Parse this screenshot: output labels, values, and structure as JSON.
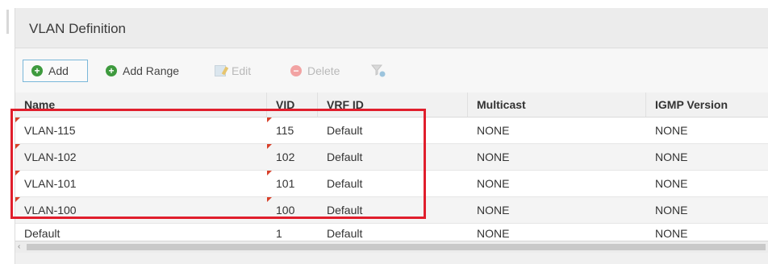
{
  "panel": {
    "title": "VLAN Definition"
  },
  "toolbar": {
    "add_label": "Add",
    "add_range_label": "Add Range",
    "edit_label": "Edit",
    "delete_label": "Delete"
  },
  "table": {
    "headers": {
      "name": "Name",
      "vid": "VID",
      "vrf": "VRF ID",
      "multicast": "Multicast",
      "igmp": "IGMP Version"
    },
    "rows": [
      {
        "name": "VLAN-115",
        "vid": "115",
        "vrf": "Default",
        "multicast": "NONE",
        "igmp": "NONE"
      },
      {
        "name": "VLAN-102",
        "vid": "102",
        "vrf": "Default",
        "multicast": "NONE",
        "igmp": "NONE"
      },
      {
        "name": "VLAN-101",
        "vid": "101",
        "vrf": "Default",
        "multicast": "NONE",
        "igmp": "NONE"
      },
      {
        "name": "VLAN-100",
        "vid": "100",
        "vrf": "Default",
        "multicast": "NONE",
        "igmp": "NONE"
      },
      {
        "name": "Default",
        "vid": "1",
        "vrf": "Default",
        "multicast": "NONE",
        "igmp": "NONE"
      }
    ]
  },
  "scrollbar": {
    "left_arrow": "‹"
  },
  "icons": {
    "add": "plus-circle-icon",
    "add_range": "plus-circle-icon",
    "edit": "edit-icon",
    "delete": "minus-circle-icon",
    "filter": "filter-icon"
  },
  "colors": {
    "highlight": "#e01e2c",
    "add_icon": "#3e9a3e",
    "delete_icon": "#f2a3a3",
    "dirty_marker": "#d8402a"
  }
}
